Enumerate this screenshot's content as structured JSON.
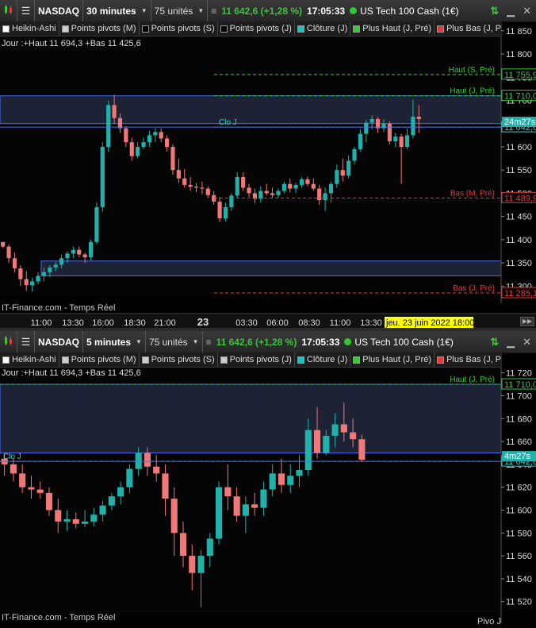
{
  "colors": {
    "bull": "#20b2aa",
    "bear": "#f07878",
    "pivot_high": "#3cc83c",
    "pivot_low": "#e03c3c",
    "close_line": "#40c8c8",
    "band_line": "#4a6cf0",
    "current_label_bg": "#20b2aa",
    "date_tag_bg": "#ffff00"
  },
  "icons": {
    "chart_type": "candlestick-icon",
    "instrument": "list-icon",
    "refresh": "refresh-arrows-icon",
    "minimize": "minimize-icon",
    "close": "close-icon"
  },
  "panels": [
    {
      "toolbar": {
        "instrument": "NASDAQ",
        "timeframe": "30 minutes",
        "units": "75 unités",
        "price_change": "11 642,6 (+1,28 %)",
        "time": "17:05:33",
        "description": "US Tech 100 Cash (1€)"
      },
      "indicators": [
        {
          "label": "Heikin-Ashi",
          "swatch": "#ffffff"
        },
        {
          "label": "Points pivots (M)",
          "swatch": "#cccccc"
        },
        {
          "label": "Points pivots (S)",
          "swatch": "#000000"
        },
        {
          "label": "Points pivots (J)",
          "swatch": "#000000"
        },
        {
          "label": "Clôture (J)",
          "swatch": "#20c0c0"
        },
        {
          "label": "Plus Haut (J, Pré)",
          "swatch": "#3cc83c"
        },
        {
          "label": "Plus Bas (J, Pré)",
          "swatch": "#e03c3c"
        }
      ],
      "info": "Jour :+Haut 11 694,3 +Bas 11 425,6",
      "watermark": "IT-Finance.com - Temps Réel",
      "countdown": "24m27s",
      "date_tag": "jeu. 23 juin 2022 18:00",
      "x_labels": [
        "11:00",
        "13:30",
        "16:00",
        "18:30",
        "21:00",
        "23",
        "03:30",
        "06:00",
        "08:30",
        "11:00",
        "13:30"
      ],
      "chart_data": {
        "type": "candlestick",
        "ylim": [
          11280,
          11860
        ],
        "y_ticks": [
          "11 850",
          "11 800",
          "11 750",
          "11 700",
          "11 650",
          "11 600",
          "11 550",
          "11 500",
          "11 450",
          "11 400",
          "11 350",
          "11 300"
        ],
        "y_tick_values": [
          11850,
          11800,
          11750,
          11700,
          11650,
          11600,
          11550,
          11500,
          11450,
          11400,
          11350,
          11300
        ],
        "levels": [
          {
            "label": "Haut (S, Pré)",
            "price_label": "11 755,9",
            "value": 11755.9,
            "kind": "pivot_high"
          },
          {
            "label": "Haut (J, Pré)",
            "price_label": "11 710,0",
            "value": 11710.0,
            "kind": "pivot_high"
          },
          {
            "label": "Clo J",
            "price_label": "11 642,6",
            "value": 11642.6,
            "kind": "close"
          },
          {
            "label": "Bas (M, Pré)",
            "price_label": "11 489,9",
            "value": 11489.9,
            "kind": "pivot_low"
          },
          {
            "label": "Bas (J, Pré)",
            "price_label": "11 285,1",
            "value": 11285.1,
            "kind": "pivot_low"
          }
        ],
        "bands": [
          [
            11650,
            11710
          ],
          [
            11322,
            11354
          ]
        ],
        "current_price": 11642.6,
        "candles": [
          [
            11395,
            11395,
            11382,
            11385
          ],
          [
            11385,
            11390,
            11350,
            11360
          ],
          [
            11360,
            11372,
            11330,
            11338
          ],
          [
            11338,
            11345,
            11300,
            11315
          ],
          [
            11315,
            11332,
            11290,
            11302
          ],
          [
            11302,
            11318,
            11288,
            11310
          ],
          [
            11310,
            11330,
            11304,
            11322
          ],
          [
            11322,
            11340,
            11310,
            11330
          ],
          [
            11330,
            11345,
            11320,
            11340
          ],
          [
            11340,
            11352,
            11332,
            11346
          ],
          [
            11346,
            11368,
            11338,
            11360
          ],
          [
            11360,
            11375,
            11350,
            11370
          ],
          [
            11370,
            11385,
            11360,
            11378
          ],
          [
            11378,
            11385,
            11362,
            11368
          ],
          [
            11368,
            11372,
            11350,
            11362
          ],
          [
            11362,
            11400,
            11355,
            11395
          ],
          [
            11395,
            11480,
            11390,
            11470
          ],
          [
            11470,
            11610,
            11460,
            11600
          ],
          [
            11600,
            11700,
            11590,
            11690
          ],
          [
            11690,
            11712,
            11650,
            11662
          ],
          [
            11662,
            11672,
            11630,
            11640
          ],
          [
            11640,
            11645,
            11600,
            11610
          ],
          [
            11610,
            11620,
            11570,
            11580
          ],
          [
            11580,
            11610,
            11575,
            11600
          ],
          [
            11600,
            11620,
            11595,
            11610
          ],
          [
            11610,
            11635,
            11600,
            11625
          ],
          [
            11625,
            11640,
            11610,
            11632
          ],
          [
            11632,
            11640,
            11610,
            11618
          ],
          [
            11618,
            11625,
            11590,
            11600
          ],
          [
            11600,
            11606,
            11540,
            11550
          ],
          [
            11550,
            11575,
            11522,
            11532
          ],
          [
            11532,
            11552,
            11512,
            11518
          ],
          [
            11518,
            11535,
            11505,
            11514
          ],
          [
            11514,
            11522,
            11502,
            11512
          ],
          [
            11512,
            11525,
            11498,
            11510
          ],
          [
            11510,
            11515,
            11490,
            11496
          ],
          [
            11496,
            11505,
            11475,
            11482
          ],
          [
            11482,
            11492,
            11438,
            11446
          ],
          [
            11446,
            11480,
            11440,
            11470
          ],
          [
            11470,
            11500,
            11462,
            11495
          ],
          [
            11495,
            11545,
            11490,
            11535
          ],
          [
            11535,
            11545,
            11505,
            11512
          ],
          [
            11512,
            11520,
            11492,
            11500
          ],
          [
            11500,
            11510,
            11478,
            11488
          ],
          [
            11488,
            11515,
            11480,
            11505
          ],
          [
            11505,
            11520,
            11495,
            11500
          ],
          [
            11500,
            11512,
            11490,
            11496
          ],
          [
            11496,
            11510,
            11490,
            11505
          ],
          [
            11505,
            11525,
            11500,
            11520
          ],
          [
            11520,
            11532,
            11502,
            11510
          ],
          [
            11510,
            11522,
            11500,
            11518
          ],
          [
            11518,
            11535,
            11512,
            11530
          ],
          [
            11530,
            11536,
            11515,
            11520
          ],
          [
            11520,
            11532,
            11505,
            11510
          ],
          [
            11510,
            11518,
            11475,
            11485
          ],
          [
            11485,
            11512,
            11462,
            11500
          ],
          [
            11500,
            11525,
            11480,
            11520
          ],
          [
            11520,
            11562,
            11512,
            11550
          ],
          [
            11550,
            11575,
            11525,
            11538
          ],
          [
            11538,
            11582,
            11532,
            11570
          ],
          [
            11570,
            11600,
            11562,
            11595
          ],
          [
            11595,
            11638,
            11590,
            11628
          ],
          [
            11628,
            11658,
            11610,
            11652
          ],
          [
            11652,
            11668,
            11638,
            11660
          ],
          [
            11660,
            11664,
            11630,
            11640
          ],
          [
            11640,
            11660,
            11632,
            11650
          ],
          [
            11650,
            11655,
            11605,
            11612
          ],
          [
            11612,
            11630,
            11600,
            11622
          ],
          [
            11622,
            11628,
            11520,
            11600
          ],
          [
            11600,
            11640,
            11595,
            11625
          ],
          [
            11625,
            11702,
            11618,
            11665
          ],
          [
            11665,
            11690,
            11630,
            11660
          ]
        ]
      }
    },
    {
      "toolbar": {
        "instrument": "NASDAQ",
        "timeframe": "5 minutes",
        "units": "75 unités",
        "price_change": "11 642,6 (+1,28 %)",
        "time": "17:05:33",
        "description": "US Tech 100 Cash (1€)"
      },
      "indicators": [
        {
          "label": "Heikin-Ashi",
          "swatch": "#ffffff"
        },
        {
          "label": "Points pivots (M)",
          "swatch": "#cccccc"
        },
        {
          "label": "Points pivots (S)",
          "swatch": "#cccccc"
        },
        {
          "label": "Points pivots (J)",
          "swatch": "#cccccc"
        },
        {
          "label": "Clôture (J)",
          "swatch": "#20c0c0"
        },
        {
          "label": "Plus Haut (J, Pré)",
          "swatch": "#3cc83c"
        },
        {
          "label": "Plus Bas (J, Pré)",
          "swatch": "#e03c3c"
        }
      ],
      "info": "Jour :+Haut 11 694,3 +Bas 11 425,6",
      "watermark": "IT-Finance.com - Temps Réel",
      "countdown": "4m27s",
      "footer_text": "Pivo J",
      "chart_data": {
        "type": "candlestick",
        "ylim": [
          11508,
          11726
        ],
        "y_ticks": [
          "11 720",
          "11 700",
          "11 680",
          "11 660",
          "11 640",
          "11 620",
          "11 600",
          "11 580",
          "11 560",
          "11 540",
          "11 520"
        ],
        "y_tick_values": [
          11720,
          11700,
          11680,
          11660,
          11640,
          11620,
          11600,
          11580,
          11560,
          11540,
          11520
        ],
        "levels": [
          {
            "label": "Haut (J, Pré)",
            "price_label": "11 710,0",
            "value": 11710.0,
            "kind": "pivot_high"
          },
          {
            "label": "Clo J",
            "price_label": "11 642,6",
            "value": 11642.6,
            "kind": "close"
          }
        ],
        "bands": [
          [
            11650,
            11710
          ]
        ],
        "current_price": 11642.6,
        "candles": [
          [
            11645,
            11650,
            11630,
            11640
          ],
          [
            11640,
            11645,
            11625,
            11632
          ],
          [
            11632,
            11640,
            11615,
            11620
          ],
          [
            11620,
            11630,
            11610,
            11618
          ],
          [
            11618,
            11625,
            11610,
            11615
          ],
          [
            11615,
            11620,
            11595,
            11600
          ],
          [
            11600,
            11610,
            11580,
            11590
          ],
          [
            11590,
            11600,
            11582,
            11592
          ],
          [
            11592,
            11598,
            11584,
            11588
          ],
          [
            11588,
            11600,
            11585,
            11590
          ],
          [
            11590,
            11602,
            11586,
            11596
          ],
          [
            11596,
            11608,
            11590,
            11604
          ],
          [
            11604,
            11615,
            11600,
            11612
          ],
          [
            11612,
            11625,
            11605,
            11620
          ],
          [
            11620,
            11640,
            11615,
            11636
          ],
          [
            11636,
            11655,
            11630,
            11650
          ],
          [
            11650,
            11655,
            11630,
            11638
          ],
          [
            11638,
            11648,
            11625,
            11632
          ],
          [
            11632,
            11640,
            11595,
            11610
          ],
          [
            11610,
            11620,
            11560,
            11580
          ],
          [
            11580,
            11590,
            11550,
            11560
          ],
          [
            11560,
            11570,
            11530,
            11545
          ],
          [
            11545,
            11565,
            11515,
            11560
          ],
          [
            11560,
            11580,
            11550,
            11575
          ],
          [
            11575,
            11625,
            11570,
            11620
          ],
          [
            11620,
            11640,
            11600,
            11612
          ],
          [
            11612,
            11620,
            11590,
            11595
          ],
          [
            11595,
            11612,
            11580,
            11605
          ],
          [
            11605,
            11615,
            11595,
            11602
          ],
          [
            11602,
            11625,
            11595,
            11618
          ],
          [
            11618,
            11640,
            11612,
            11632
          ],
          [
            11632,
            11645,
            11615,
            11622
          ],
          [
            11622,
            11640,
            11615,
            11630
          ],
          [
            11630,
            11648,
            11620,
            11635
          ],
          [
            11635,
            11680,
            11630,
            11670
          ],
          [
            11670,
            11690,
            11645,
            11650
          ],
          [
            11650,
            11670,
            11648,
            11665
          ],
          [
            11665,
            11685,
            11655,
            11675
          ],
          [
            11675,
            11694,
            11660,
            11668
          ],
          [
            11668,
            11680,
            11655,
            11662
          ],
          [
            11662,
            11666,
            11642,
            11644
          ]
        ]
      }
    }
  ]
}
